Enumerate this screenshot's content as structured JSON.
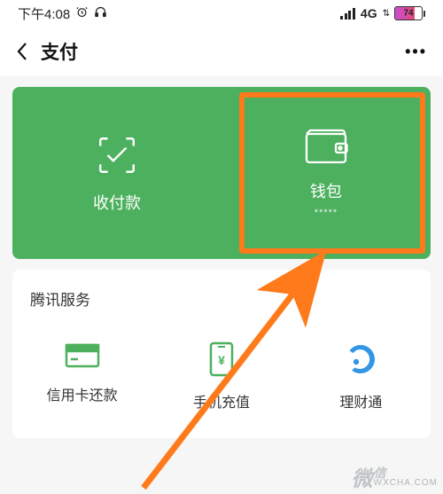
{
  "statusbar": {
    "time": "下午4:08",
    "net_label": "4G",
    "battery_pct": "74"
  },
  "header": {
    "title": "支付"
  },
  "main_card": {
    "pay": {
      "label": "收付款"
    },
    "wallet": {
      "label": "钱包",
      "masked": "*****"
    }
  },
  "services": {
    "title": "腾讯服务",
    "items": [
      {
        "label": "信用卡还款"
      },
      {
        "label": "手机充值"
      },
      {
        "label": "理财通"
      }
    ]
  },
  "watermark": {
    "brand": "微",
    "sub": "WXCHA.COM"
  },
  "highlight_target": "wallet"
}
